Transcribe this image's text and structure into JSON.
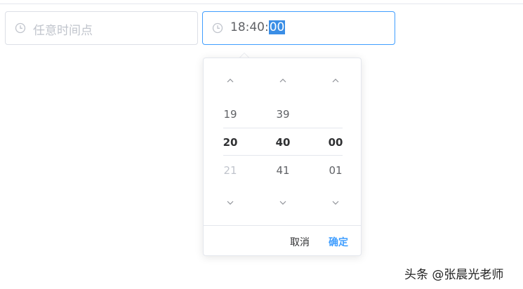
{
  "start_picker": {
    "placeholder": "任意时间点",
    "icon": "clock-icon"
  },
  "end_picker": {
    "value_prefix": "18:40:",
    "value_selected": "00",
    "icon": "clock-icon"
  },
  "panel": {
    "columns": [
      {
        "name": "hours",
        "above": "19",
        "selected": "20",
        "below": "21",
        "below_disabled": true
      },
      {
        "name": "minutes",
        "above": "39",
        "selected": "40",
        "below": "41",
        "below_disabled": false
      },
      {
        "name": "seconds",
        "above": "",
        "selected": "00",
        "below": "01",
        "below_disabled": false
      }
    ],
    "cancel_label": "取消",
    "confirm_label": "确定"
  },
  "watermark": "头条 @张晨光老师",
  "colors": {
    "accent": "#409eff",
    "selection": "#3a8ee6",
    "border": "#dcdfe6",
    "placeholder": "#c0c4cc"
  }
}
